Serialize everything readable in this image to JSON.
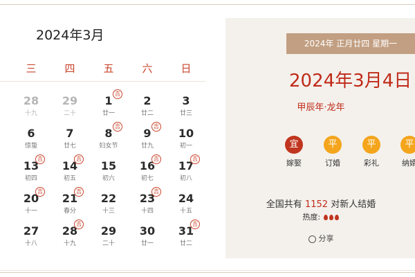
{
  "calendar": {
    "month_title": "2024年3月",
    "weekdays": [
      "三",
      "四",
      "五",
      "六",
      "日"
    ],
    "rows": [
      [
        {
          "num": "28",
          "sub": "十九",
          "grey": true
        },
        {
          "num": "29",
          "sub": "二十",
          "grey": true
        },
        {
          "num": "1",
          "sub": "廿一",
          "badge": "吉"
        },
        {
          "num": "2",
          "sub": "廿二"
        },
        {
          "num": "3",
          "sub": "廿三"
        }
      ],
      [
        {
          "num": "6",
          "sub": "惊蛰"
        },
        {
          "num": "7",
          "sub": "廿七"
        },
        {
          "num": "8",
          "sub": "妇女节",
          "badge": "吉"
        },
        {
          "num": "9",
          "sub": "廿九",
          "badge": "吉"
        },
        {
          "num": "10",
          "sub": "初一"
        }
      ],
      [
        {
          "num": "13",
          "sub": "初四",
          "badge": "吉"
        },
        {
          "num": "14",
          "sub": "初五",
          "badge": "吉"
        },
        {
          "num": "15",
          "sub": "初六"
        },
        {
          "num": "16",
          "sub": "初七",
          "badge": "吉"
        },
        {
          "num": "17",
          "sub": "初八",
          "badge": "吉"
        }
      ],
      [
        {
          "num": "20",
          "sub": "十一",
          "badge": "吉"
        },
        {
          "num": "21",
          "sub": "春分",
          "badge": "吉"
        },
        {
          "num": "22",
          "sub": "十三"
        },
        {
          "num": "23",
          "sub": "十四",
          "badge": "吉"
        },
        {
          "num": "24",
          "sub": "十五"
        }
      ],
      [
        {
          "num": "27",
          "sub": "十八"
        },
        {
          "num": "28",
          "sub": "十九",
          "badge": "吉"
        },
        {
          "num": "29",
          "sub": "二十"
        },
        {
          "num": "30",
          "sub": "廿一"
        },
        {
          "num": "31",
          "sub": "廿二",
          "badge": "吉"
        }
      ]
    ]
  },
  "panel": {
    "date_bar": "2024年  正月廿四  星期一",
    "big_date": "2024年3月4日",
    "ganzhi": "甲辰年·龙年",
    "activities": [
      {
        "icon": "宜",
        "label": "嫁娶",
        "good": true
      },
      {
        "icon": "平",
        "label": "订婚"
      },
      {
        "icon": "平",
        "label": "彩礼"
      },
      {
        "icon": "平",
        "label": "纳婿"
      }
    ],
    "summary_prefix": "全国共有",
    "summary_count": "1152",
    "summary_suffix": "对新人结婚",
    "heat_label": "热度:",
    "share_label": "分享"
  }
}
